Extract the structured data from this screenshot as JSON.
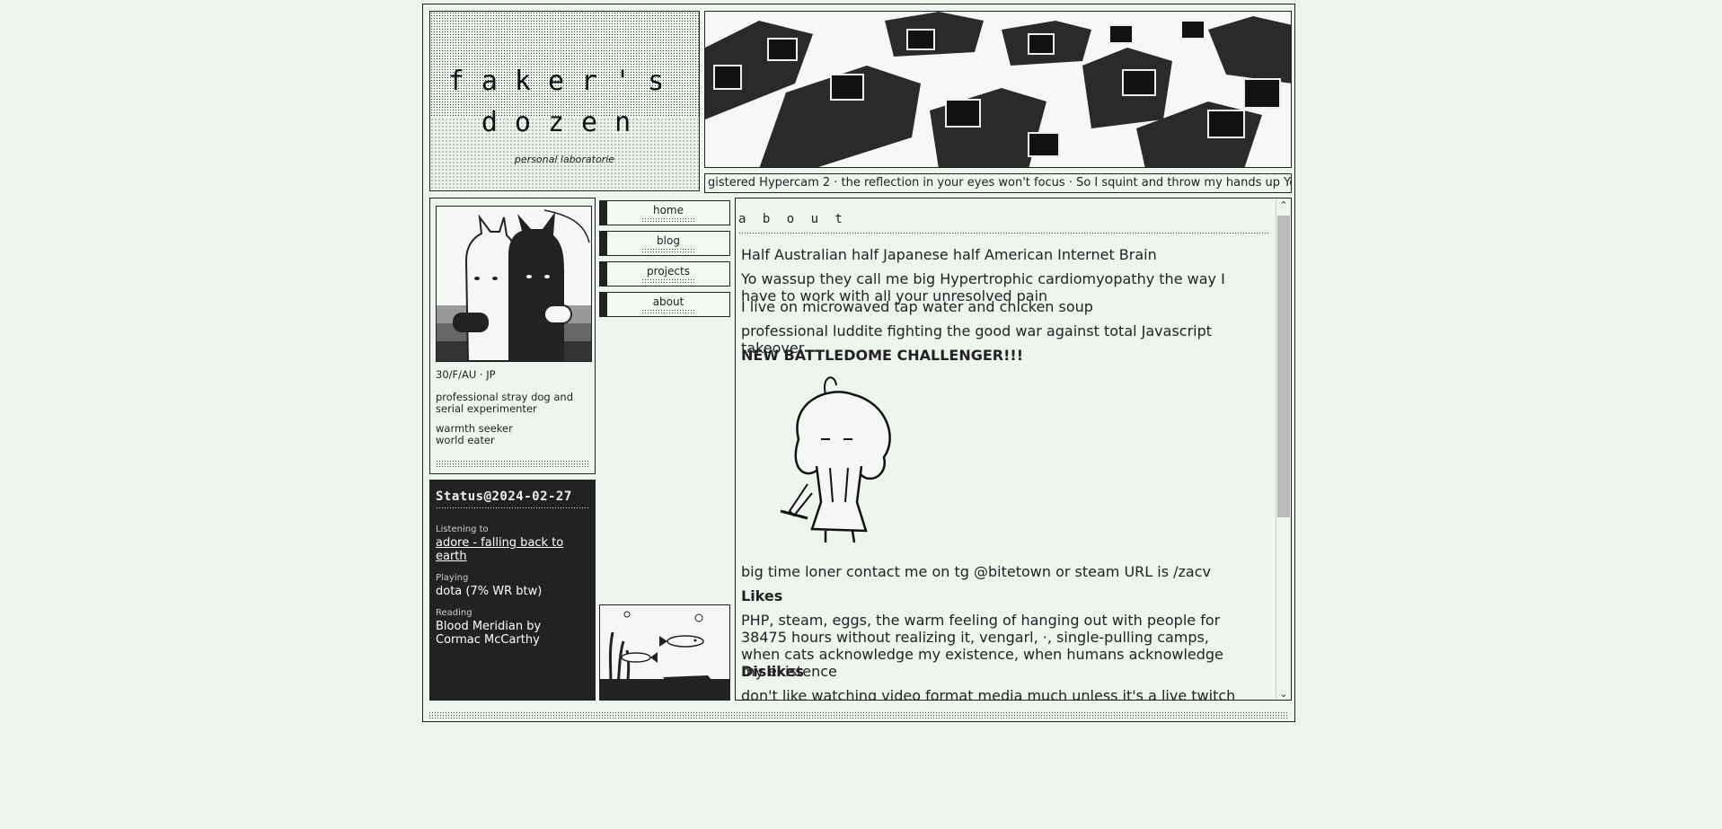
{
  "site": {
    "title": "f a k e r ' s  d o z e n",
    "title_line1": "faker's",
    "title_line2": "dozen",
    "subtitle": "personal laboratorie"
  },
  "marquee": {
    "text": "gistered Hypercam 2 ·   the reflection in your eyes won't focus ·   So I squint and throw my hands up Yo"
  },
  "profile": {
    "age_loc": "30/F/AU · JP",
    "bio1": "professional stray dog and serial experimenter",
    "bio2_line1": "warmth seeker",
    "bio2_line2": "world eater"
  },
  "status": {
    "heading": "Status@2024-02-27",
    "listening_label": "Listening to",
    "listening_value": "adore - falling back to earth",
    "playing_label": "Playing",
    "playing_value": "dota (7% WR btw)",
    "reading_label": "Reading",
    "reading_value": "Blood Meridian by Cormac McCarthy"
  },
  "nav": {
    "home": "home",
    "blog": "blog",
    "projects": "projects",
    "about": "about"
  },
  "about": {
    "heading": "a b o u t",
    "p1": "Half Australian half Japanese half American Internet Brain",
    "p2a": "Yo wassup they call me big Hypertrophic cardiomyopathy the way I have to work with all your unresolved pain",
    "p2b": "I live on microwaved tap water and chicken soup",
    "p3": "professional luddite fighting the good war against total Javascript takeover",
    "p4": "NEW BATTLEDOME CHALLENGER!!!",
    "p5": "big time loner contact me on tg @bitetown or steam URL is /zacv",
    "likes_heading": "Likes",
    "likes": "PHP, steam, eggs, the warm feeling of hanging out with people for 38475 hours without realizing it, vengarl, ·, single-pulling camps, when cats acknowledge my existence, when humans acknowledge my existence",
    "dislikes_heading": "Dislikes",
    "dislikes": "don't like watching video format media much unless it's a live twitch stream which is half my"
  },
  "colors": {
    "background": "#eef5ee",
    "ink": "#222222",
    "status_bg": "#222222"
  }
}
